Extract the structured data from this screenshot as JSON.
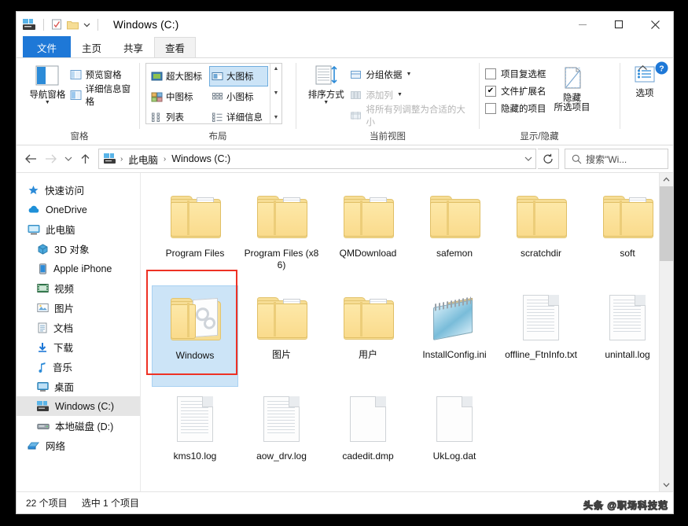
{
  "window": {
    "title": "Windows (C:)",
    "quick_access": [
      "explorer-icon",
      "properties-icon",
      "new-folder-icon",
      "customize-caret"
    ],
    "controls": {
      "minimize": "—",
      "maximize": "□",
      "close": "✕",
      "collapse_ribbon": "˄",
      "help": "?"
    }
  },
  "tabs": [
    {
      "label": "文件",
      "state": "file"
    },
    {
      "label": "主页",
      "state": "normal"
    },
    {
      "label": "共享",
      "state": "normal"
    },
    {
      "label": "查看",
      "state": "active"
    }
  ],
  "ribbon": {
    "groups": [
      {
        "label": "窗格",
        "big_button": {
          "label": "导航窗格",
          "icon": "navigation-pane-icon",
          "has_caret": true
        },
        "items": [
          {
            "label": "预览窗格",
            "icon": "preview-pane-icon",
            "disabled": false
          },
          {
            "label": "详细信息窗格",
            "icon": "details-pane-icon",
            "disabled": false
          }
        ]
      },
      {
        "label": "布局",
        "gallery": [
          {
            "label": "超大图标",
            "icon": "extra-large-icons-icon",
            "selected": false
          },
          {
            "label": "大图标",
            "icon": "large-icons-icon",
            "selected": true
          },
          {
            "label": "中图标",
            "icon": "medium-icons-icon",
            "selected": false
          },
          {
            "label": "小图标",
            "icon": "small-icons-icon",
            "selected": false
          },
          {
            "label": "列表",
            "icon": "list-view-icon",
            "selected": false
          },
          {
            "label": "详细信息",
            "icon": "details-view-icon",
            "selected": false
          }
        ]
      },
      {
        "label": "当前视图",
        "big_button": {
          "label": "排序方式",
          "icon": "sort-by-icon",
          "has_caret": true
        },
        "items": [
          {
            "label": "分组依据",
            "icon": "group-by-icon",
            "disabled": false,
            "has_caret": true
          },
          {
            "label": "添加列",
            "icon": "add-columns-icon",
            "disabled": true,
            "has_caret": true
          },
          {
            "label": "将所有列调整为合适的大小",
            "icon": "size-columns-icon",
            "disabled": true
          }
        ]
      },
      {
        "label": "显示/隐藏",
        "checkboxes": [
          {
            "label": "项目复选框",
            "checked": false
          },
          {
            "label": "文件扩展名",
            "checked": true
          },
          {
            "label": "隐藏的项目",
            "checked": false
          }
        ],
        "big_button": {
          "label": "隐藏\n所选项目",
          "label_line1": "隐藏",
          "label_line2": "所选项目",
          "icon": "hide-selected-items-icon"
        }
      },
      {
        "label": "",
        "big_button": {
          "label": "选项",
          "icon": "options-icon"
        }
      }
    ]
  },
  "address_bar": {
    "back": "←",
    "forward": "→",
    "recent_caret": "˅",
    "up": "↑",
    "breadcrumbs": [
      {
        "label": "",
        "icon": "this-pc-small-icon"
      },
      {
        "label": "此电脑"
      },
      {
        "label": "Windows (C:)"
      }
    ],
    "dropdown_caret": "˅",
    "refresh": "↻",
    "search_placeholder": "搜索\"Wi...",
    "search_icon": "search-icon"
  },
  "sidebar": {
    "items": [
      {
        "label": "快速访问",
        "icon": "star-pin-icon",
        "indent": false,
        "selected": false
      },
      {
        "label": "OneDrive",
        "icon": "cloud-icon",
        "indent": false,
        "selected": false
      },
      {
        "label": "此电脑",
        "icon": "this-pc-icon",
        "indent": false,
        "selected": false
      },
      {
        "label": "3D 对象",
        "icon": "3d-objects-icon",
        "indent": true,
        "selected": false
      },
      {
        "label": "Apple iPhone",
        "icon": "iphone-icon",
        "indent": true,
        "selected": false
      },
      {
        "label": "视频",
        "icon": "videos-icon",
        "indent": true,
        "selected": false
      },
      {
        "label": "图片",
        "icon": "pictures-icon",
        "indent": true,
        "selected": false
      },
      {
        "label": "文档",
        "icon": "documents-icon",
        "indent": true,
        "selected": false
      },
      {
        "label": "下载",
        "icon": "downloads-icon",
        "indent": true,
        "selected": false
      },
      {
        "label": "音乐",
        "icon": "music-icon",
        "indent": true,
        "selected": false
      },
      {
        "label": "桌面",
        "icon": "desktop-icon",
        "indent": true,
        "selected": false
      },
      {
        "label": "Windows (C:)",
        "icon": "drive-windows-icon",
        "indent": true,
        "selected": true
      },
      {
        "label": "本地磁盘 (D:)",
        "icon": "drive-local-icon",
        "indent": true,
        "selected": false
      },
      {
        "label": "网络",
        "icon": "network-icon",
        "indent": false,
        "selected": false
      }
    ]
  },
  "files": [
    {
      "name": "Program Files",
      "type": "folder-filled",
      "selected": false
    },
    {
      "name": "Program Files (x86)",
      "type": "folder-filled",
      "selected": false
    },
    {
      "name": "QMDownload",
      "type": "folder-filled",
      "selected": false
    },
    {
      "name": "safemon",
      "type": "folder-empty",
      "selected": false
    },
    {
      "name": "scratchdir",
      "type": "folder-empty",
      "selected": false
    },
    {
      "name": "soft",
      "type": "folder-filled",
      "selected": false
    },
    {
      "name": "Windows",
      "type": "folder-system",
      "selected": true
    },
    {
      "name": "图片",
      "type": "folder-filled",
      "selected": false
    },
    {
      "name": "用户",
      "type": "folder-filled",
      "selected": false
    },
    {
      "name": "InstallConfig.ini",
      "type": "notepad-file",
      "selected": false
    },
    {
      "name": "offline_FtnInfo.txt",
      "type": "text-file",
      "selected": false
    },
    {
      "name": "unintall.log",
      "type": "text-file",
      "selected": false
    },
    {
      "name": "kms10.log",
      "type": "text-file",
      "selected": false
    },
    {
      "name": "aow_drv.log",
      "type": "text-file",
      "selected": false
    },
    {
      "name": "cadedit.dmp",
      "type": "blank-file",
      "selected": false
    },
    {
      "name": "UkLog.dat",
      "type": "blank-file",
      "selected": false
    }
  ],
  "status_bar": {
    "item_count": "22 个项目",
    "selection": "选中 1 个项目"
  },
  "watermark": "头条 @职场科技范",
  "colors": {
    "accent": "#1e78d7",
    "selection": "#cce4f7",
    "annotation": "#ee3124",
    "folder": "#f6dd95"
  }
}
